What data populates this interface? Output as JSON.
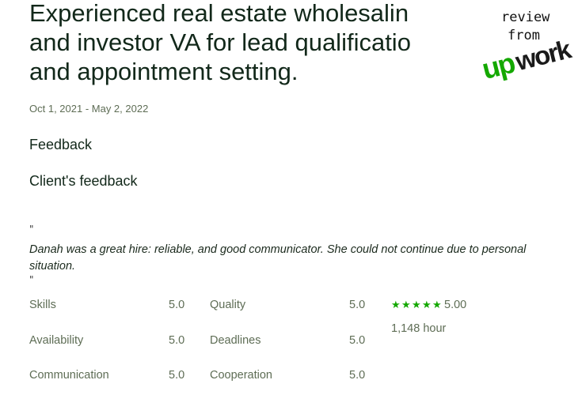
{
  "job": {
    "title_lines": [
      "Experienced real estate wholesalin",
      "and investor VA for lead qualificatio",
      "and appointment setting."
    ],
    "dates": "Oct 1, 2021 - May 2, 2022"
  },
  "feedback": {
    "heading": "Feedback",
    "client_heading": "Client's feedback",
    "quote_open": "\"",
    "quote_close": "\"",
    "text": "Danah was a great hire: reliable, and good communicator. She could not continue due to personal situation."
  },
  "ratings": {
    "left": [
      {
        "label": "Skills",
        "score": "5.0"
      },
      {
        "label": "Availability",
        "score": "5.0"
      },
      {
        "label": "Communication",
        "score": "5.0"
      }
    ],
    "right": [
      {
        "label": "Quality",
        "score": "5.0"
      },
      {
        "label": "Deadlines",
        "score": "5.0"
      },
      {
        "label": "Cooperation",
        "score": "5.0"
      }
    ],
    "overall": "5.00",
    "star_count": 5,
    "hours": "1,148 hour"
  },
  "badge": {
    "review": "review",
    "from": "from",
    "brand": "upwork",
    "brand_color": "#14a800"
  },
  "colors": {
    "text_dark": "#12281a",
    "text_muted": "#5e6d55",
    "star": "#14a800"
  }
}
